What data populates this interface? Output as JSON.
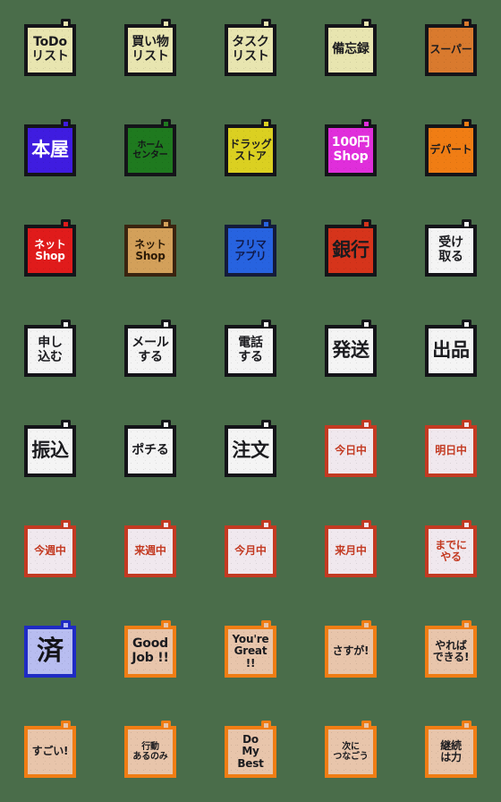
{
  "sheet": {
    "background_color": "#4a6d4a",
    "columns": 5,
    "rows": 8,
    "sticker_shape": "square-sticky-note-with-tab"
  },
  "stickers": [
    {
      "id": "todo-list",
      "text": "ToDo\nリスト",
      "fill": "#e8e5b0",
      "border": "#141419",
      "text_color": "#1b1b1f",
      "size": "t-md"
    },
    {
      "id": "shopping-list",
      "text": "買い物\nリスト",
      "fill": "#e8e5b0",
      "border": "#141419",
      "text_color": "#1b1b1f",
      "size": "t-md"
    },
    {
      "id": "task-list",
      "text": "タスク\nリスト",
      "fill": "#e8e5b0",
      "border": "#141419",
      "text_color": "#1b1b1f",
      "size": "t-md"
    },
    {
      "id": "memo",
      "text": "備忘録",
      "fill": "#e8e5b0",
      "border": "#141419",
      "text_color": "#1b1b1f",
      "size": "t-md"
    },
    {
      "id": "supermarket",
      "text": "スーパー",
      "fill": "#d97a2e",
      "border": "#141419",
      "text_color": "#1b1b1f",
      "size": "t-sm"
    },
    {
      "id": "bookstore",
      "text": "本屋",
      "fill": "#3f1ce0",
      "border": "#141419",
      "text_color": "#ffffff",
      "size": "t-lg"
    },
    {
      "id": "home-center",
      "text": "ホーム\nセンター",
      "fill": "#1f7a1f",
      "border": "#141419",
      "text_color": "#141419",
      "size": "t-xs"
    },
    {
      "id": "drug-store",
      "text": "ドラッグ\nストア",
      "fill": "#dbd021",
      "border": "#141419",
      "text_color": "#1b1b1f",
      "size": "t-sm"
    },
    {
      "id": "hundred-yen-shop",
      "text": "100円\nShop",
      "fill": "#e02edb",
      "border": "#141419",
      "text_color": "#ffffff",
      "size": "t-md"
    },
    {
      "id": "department-store",
      "text": "デパート",
      "fill": "#f07d14",
      "border": "#141419",
      "text_color": "#1b1b1f",
      "size": "t-sm"
    },
    {
      "id": "net-shop-red",
      "text": "ネット\nShop",
      "fill": "#e01b1b",
      "border": "#141419",
      "text_color": "#ffffff",
      "size": "t-sm"
    },
    {
      "id": "net-shop-tan",
      "text": "ネット\nShop",
      "fill": "#d3a05a",
      "border": "#3a2410",
      "text_color": "#2b1a07",
      "size": "t-sm"
    },
    {
      "id": "flea-market-app",
      "text": "フリマ\nアプリ",
      "fill": "#2763e0",
      "border": "#141b3a",
      "text_color": "#101a4a",
      "size": "t-sm"
    },
    {
      "id": "bank",
      "text": "銀行",
      "fill": "#d6341b",
      "border": "#141419",
      "text_color": "#1b1b1f",
      "size": "t-lg"
    },
    {
      "id": "receive",
      "text": "受け\n取る",
      "fill": "#f4f4f4",
      "border": "#141419",
      "text_color": "#1b1b1f",
      "size": "t-md"
    },
    {
      "id": "apply",
      "text": "申し\n込む",
      "fill": "#f4f4f4",
      "border": "#141419",
      "text_color": "#1b1b1f",
      "size": "t-md"
    },
    {
      "id": "send-mail",
      "text": "メール\nする",
      "fill": "#f4f4f4",
      "border": "#141419",
      "text_color": "#1b1b1f",
      "size": "t-md"
    },
    {
      "id": "make-call",
      "text": "電話\nする",
      "fill": "#f4f4f4",
      "border": "#141419",
      "text_color": "#1b1b1f",
      "size": "t-md"
    },
    {
      "id": "ship",
      "text": "発送",
      "fill": "#f4f4f4",
      "border": "#141419",
      "text_color": "#1b1b1f",
      "size": "t-lg"
    },
    {
      "id": "list-item-sale",
      "text": "出品",
      "fill": "#f4f4f4",
      "border": "#141419",
      "text_color": "#1b1b1f",
      "size": "t-lg"
    },
    {
      "id": "bank-transfer",
      "text": "振込",
      "fill": "#f4f4f4",
      "border": "#141419",
      "text_color": "#1b1b1f",
      "size": "t-lg"
    },
    {
      "id": "buy-click",
      "text": "ポチる",
      "fill": "#f4f4f4",
      "border": "#141419",
      "text_color": "#1b1b1f",
      "size": "t-md"
    },
    {
      "id": "order",
      "text": "注文",
      "fill": "#f4f4f4",
      "border": "#141419",
      "text_color": "#1b1b1f",
      "size": "t-lg"
    },
    {
      "id": "by-today",
      "text": "今日中",
      "fill": "#f0e8ee",
      "border": "#c33a22",
      "text_color": "#c33a22",
      "size": "t-sm"
    },
    {
      "id": "by-tomorrow",
      "text": "明日中",
      "fill": "#f0e8ee",
      "border": "#c33a22",
      "text_color": "#c33a22",
      "size": "t-sm"
    },
    {
      "id": "this-week",
      "text": "今週中",
      "fill": "#f0e8ee",
      "border": "#c33a22",
      "text_color": "#c33a22",
      "size": "t-sm"
    },
    {
      "id": "next-week",
      "text": "来週中",
      "fill": "#f0e8ee",
      "border": "#c33a22",
      "text_color": "#c33a22",
      "size": "t-sm"
    },
    {
      "id": "this-month",
      "text": "今月中",
      "fill": "#f0e8ee",
      "border": "#c33a22",
      "text_color": "#c33a22",
      "size": "t-sm"
    },
    {
      "id": "next-month",
      "text": "来月中",
      "fill": "#f0e8ee",
      "border": "#c33a22",
      "text_color": "#c33a22",
      "size": "t-sm"
    },
    {
      "id": "do-it-by-then",
      "text": "までに\nやる",
      "fill": "#f0e8ee",
      "border": "#c33a22",
      "text_color": "#c33a22",
      "size": "t-sm"
    },
    {
      "id": "done",
      "text": "済",
      "fill": "#b8bdf0",
      "border": "#1f2bc4",
      "text_color": "#141419",
      "size": "t-huge"
    },
    {
      "id": "good-job",
      "text": "Good\nJob !!",
      "fill": "#e8c5ab",
      "border": "#f07d14",
      "text_color": "#1b1b1f",
      "size": "t-md"
    },
    {
      "id": "youre-great",
      "text": "You're\nGreat !!",
      "fill": "#e8c5ab",
      "border": "#f07d14",
      "text_color": "#1b1b1f",
      "size": "t-sm"
    },
    {
      "id": "as-expected",
      "text": "さすが!",
      "fill": "#e8c5ab",
      "border": "#f07d14",
      "text_color": "#1b1b1f",
      "size": "t-sm"
    },
    {
      "id": "you-can-do-it",
      "text": "やれば\nできる!",
      "fill": "#e8c5ab",
      "border": "#f07d14",
      "text_color": "#1b1b1f",
      "size": "t-sm"
    },
    {
      "id": "amazing",
      "text": "すごい!",
      "fill": "#e8c5ab",
      "border": "#f07d14",
      "text_color": "#1b1b1f",
      "size": "t-sm"
    },
    {
      "id": "just-act",
      "text": "行動\nあるのみ",
      "fill": "#e8c5ab",
      "border": "#f07d14",
      "text_color": "#1b1b1f",
      "size": "t-xs"
    },
    {
      "id": "do-my-best",
      "text": "Do\nMy Best",
      "fill": "#e8c5ab",
      "border": "#f07d14",
      "text_color": "#1b1b1f",
      "size": "t-sm"
    },
    {
      "id": "connect-to-next",
      "text": "次に\nつなごう",
      "fill": "#e8c5ab",
      "border": "#f07d14",
      "text_color": "#1b1b1f",
      "size": "t-xs"
    },
    {
      "id": "persistence",
      "text": "継続\nは力",
      "fill": "#e8c5ab",
      "border": "#f07d14",
      "text_color": "#1b1b1f",
      "size": "t-sm"
    }
  ]
}
